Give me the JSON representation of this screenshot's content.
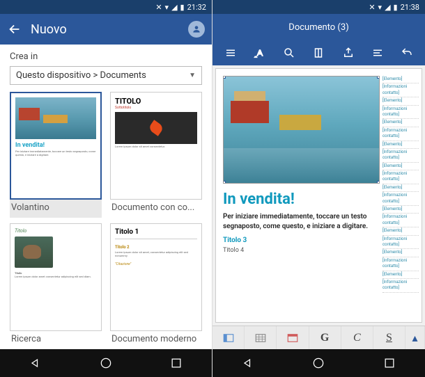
{
  "left": {
    "status_time": "21:32",
    "header_title": "Nuovo",
    "crea_label": "Crea in",
    "dropdown_value": "Questo dispositivo > Documents",
    "templates": [
      {
        "label": "Volantino",
        "heading": "In vendita!",
        "sub": "Per iniziare immediatamente, toccare un testo segnaposto, come questo, e iniziare a digitare."
      },
      {
        "label": "Documento con co...",
        "heading": "TITOLO",
        "sub": "Sottotitolo"
      },
      {
        "label": "Ricerca",
        "heading": "Titolo",
        "sub": ""
      },
      {
        "label": "Documento moderno",
        "heading": "Titolo 1",
        "sub": "\"Citazione\""
      }
    ]
  },
  "right": {
    "status_time": "21:38",
    "doc_title": "Documento (3)",
    "doc_h1": "In vendita!",
    "doc_body": "Per iniziare immediatamente, toccare un testo segnaposto, come questo, e iniziare a digitare.",
    "doc_h3": "Titolo 3",
    "doc_h4": "Titolo 4",
    "placeholders": [
      "[Elemento]",
      "[Informazioni contatto]",
      "[Elemento]",
      "[Informazioni contatto]",
      "[Elemento]",
      "[Informazioni contatto]",
      "[Elemento]",
      "[Informazioni contatto]",
      "[Elemento]",
      "[Informazioni contatto]",
      "[Elemento]",
      "[Informazioni contatto]",
      "[Elemento]",
      "[Informazioni contatto]",
      "[Elemento]",
      "[Informazioni contatto]",
      "[Elemento]",
      "[Informazioni contatto]",
      "[Elemento]",
      "[Informazioni contatto]"
    ],
    "fmt": {
      "bold": "G",
      "italic": "C",
      "underline": "S"
    }
  }
}
